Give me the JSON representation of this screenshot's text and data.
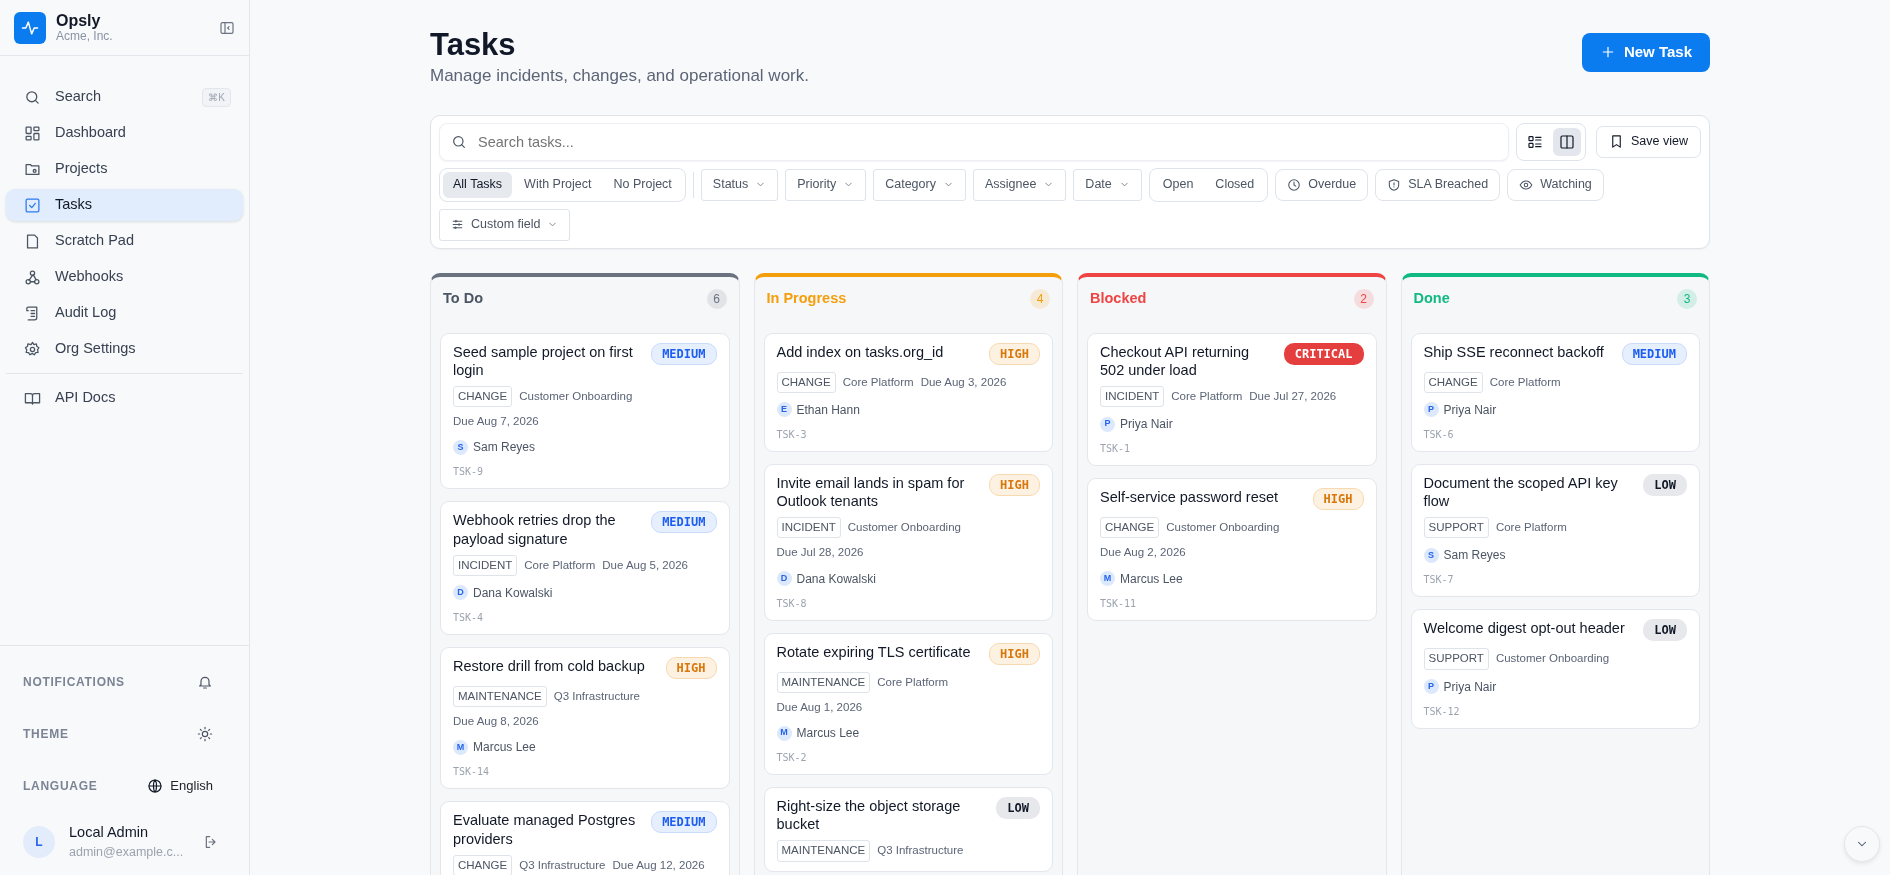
{
  "brand": {
    "name": "Opsly",
    "org": "Acme, Inc."
  },
  "nav": [
    {
      "label": "Search",
      "shortcut": "⌘K",
      "selected": false
    },
    {
      "label": "Dashboard",
      "selected": false
    },
    {
      "label": "Projects",
      "selected": false
    },
    {
      "label": "Tasks",
      "selected": true
    },
    {
      "label": "Scratch Pad",
      "selected": false
    },
    {
      "label": "Webhooks",
      "selected": false
    },
    {
      "label": "Audit Log",
      "selected": false
    },
    {
      "label": "Org Settings",
      "selected": false
    }
  ],
  "nav_secondary": [
    {
      "label": "API Docs",
      "selected": false
    }
  ],
  "settings": [
    {
      "kind": "notifications",
      "label": "NOTIFICATIONS"
    },
    {
      "kind": "theme",
      "label": "THEME"
    },
    {
      "kind": "language",
      "label": "LANGUAGE",
      "value": "English"
    }
  ],
  "user": {
    "initial": "L",
    "name": "Local Admin",
    "email": "admin@example.c..."
  },
  "page": {
    "title": "Tasks",
    "subtitle": "Manage incidents, changes, and operational work.",
    "new_button": "New Task"
  },
  "toolbar": {
    "search_placeholder": "Search tasks...",
    "views": [
      {
        "kind": "list",
        "selected": false
      },
      {
        "kind": "board",
        "selected": true
      }
    ],
    "save_view": "Save view",
    "scope": [
      {
        "label": "All Tasks",
        "selected": true
      },
      {
        "label": "With Project",
        "selected": false
      },
      {
        "label": "No Project",
        "selected": false
      }
    ],
    "dropdowns": [
      "Status",
      "Priority",
      "Category",
      "Assignee",
      "Date"
    ],
    "state": [
      {
        "label": "Open",
        "selected": false
      },
      {
        "label": "Closed",
        "selected": false
      }
    ],
    "toggles": [
      {
        "kind": "overdue",
        "label": "Overdue"
      },
      {
        "kind": "sla",
        "label": "SLA Breached"
      },
      {
        "kind": "watching",
        "label": "Watching"
      }
    ],
    "custom_field": "Custom field"
  },
  "columns": [
    {
      "title": "To Do",
      "count": "6",
      "color": "#6b7280",
      "cards": [
        {
          "title": "Seed sample project on first login",
          "priority": "MEDIUM",
          "kind": "medium",
          "tag": "CHANGE",
          "project": "Customer Onboarding",
          "due": "Due Aug 7, 2026",
          "initial": "S",
          "assignee": "Sam Reyes",
          "id": "TSK-9"
        },
        {
          "title": "Webhook retries drop the payload signature",
          "priority": "MEDIUM",
          "kind": "medium",
          "tag": "INCIDENT",
          "project": "Core Platform",
          "due": "Due Aug 5, 2026",
          "initial": "D",
          "assignee": "Dana Kowalski",
          "id": "TSK-4"
        },
        {
          "title": "Restore drill from cold backup",
          "priority": "HIGH",
          "kind": "high",
          "tag": "MAINTENANCE",
          "project": "Q3 Infrastructure",
          "due": "Due Aug 8, 2026",
          "initial": "M",
          "assignee": "Marcus Lee",
          "id": "TSK-14"
        },
        {
          "title": "Evaluate managed Postgres providers",
          "priority": "MEDIUM",
          "kind": "medium",
          "tag": "CHANGE",
          "project": "Q3 Infrastructure",
          "due": "Due Aug 12, 2026"
        }
      ]
    },
    {
      "title": "In Progress",
      "count": "4",
      "color": "#f59e0b",
      "cards": [
        {
          "title": "Add index on tasks.org_id",
          "priority": "HIGH",
          "kind": "high",
          "tag": "CHANGE",
          "project": "Core Platform",
          "due": "Due Aug 3, 2026",
          "initial": "E",
          "assignee": "Ethan Hann",
          "id": "TSK-3"
        },
        {
          "title": "Invite email lands in spam for Outlook tenants",
          "priority": "HIGH",
          "kind": "high",
          "tag": "INCIDENT",
          "project": "Customer Onboarding",
          "due": "Due Jul 28, 2026",
          "initial": "D",
          "assignee": "Dana Kowalski",
          "id": "TSK-8"
        },
        {
          "title": "Rotate expiring TLS certificate",
          "priority": "HIGH",
          "kind": "high",
          "tag": "MAINTENANCE",
          "project": "Core Platform",
          "due": "Due Aug 1, 2026",
          "initial": "M",
          "assignee": "Marcus Lee",
          "id": "TSK-2"
        },
        {
          "title": "Right-size the object storage bucket",
          "priority": "LOW",
          "kind": "low",
          "tag": "MAINTENANCE",
          "project": "Q3 Infrastructure"
        }
      ]
    },
    {
      "title": "Blocked",
      "count": "2",
      "color": "#ef4444",
      "cards": [
        {
          "title": "Checkout API returning 502 under load",
          "priority": "CRITICAL",
          "kind": "critical",
          "tag": "INCIDENT",
          "project": "Core Platform",
          "due": "Due Jul 27, 2026",
          "initial": "P",
          "assignee": "Priya Nair",
          "id": "TSK-1"
        },
        {
          "title": "Self-service password reset",
          "priority": "HIGH",
          "kind": "high",
          "tag": "CHANGE",
          "project": "Customer Onboarding",
          "due": "Due Aug 2, 2026",
          "initial": "M",
          "assignee": "Marcus Lee",
          "id": "TSK-11"
        }
      ]
    },
    {
      "title": "Done",
      "count": "3",
      "color": "#10b981",
      "cards": [
        {
          "title": "Ship SSE reconnect backoff",
          "priority": "MEDIUM",
          "kind": "medium",
          "tag": "CHANGE",
          "project": "Core Platform",
          "initial": "P",
          "assignee": "Priya Nair",
          "id": "TSK-6"
        },
        {
          "title": "Document the scoped API key flow",
          "priority": "LOW",
          "kind": "low",
          "tag": "SUPPORT",
          "project": "Core Platform",
          "initial": "S",
          "assignee": "Sam Reyes",
          "id": "TSK-7"
        },
        {
          "title": "Welcome digest opt-out header",
          "priority": "LOW",
          "kind": "low",
          "tag": "SUPPORT",
          "project": "Customer Onboarding",
          "initial": "P",
          "assignee": "Priya Nair",
          "id": "TSK-12"
        }
      ]
    }
  ]
}
